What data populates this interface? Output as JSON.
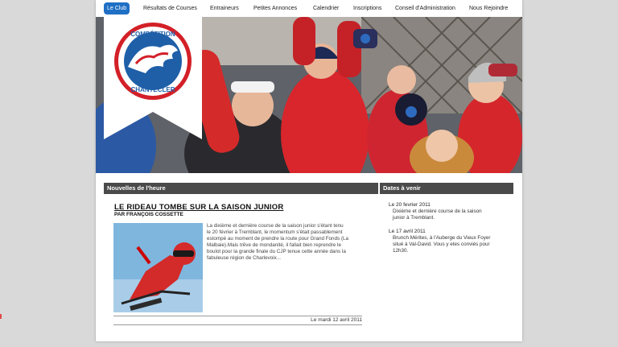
{
  "nav": {
    "items": [
      {
        "label": "Le Club",
        "active": true
      },
      {
        "label": "Résultats de Courses",
        "active": false
      },
      {
        "label": "Entraineurs",
        "active": false
      },
      {
        "label": "Petites Annonces",
        "active": false
      },
      {
        "label": "Calendrier",
        "active": false
      },
      {
        "label": "Inscriptions",
        "active": false
      },
      {
        "label": "Conseil d'Administration",
        "active": false
      },
      {
        "label": "Nous Rejoindre",
        "active": false
      }
    ]
  },
  "logo": {
    "text_top": "COMPÉTITION",
    "text_bottom": "CHANTECLER"
  },
  "news": {
    "section_title": "Nouvelles de l'heure",
    "article": {
      "title": "LE RIDEAU TOMBE SUR LA SAISON JUNIOR",
      "byline": "PAR FRANÇOIS COSSETTE",
      "body_lines": [
        "La dixième et dernière course de la saison junior s'étant tenu",
        "le 20 février à Tremblant, le momentum s'était passablement",
        "estompé au moment de prendre la route pour Grand Fonds (La",
        "Malbaie).Mais trêve de mondanité, il fallait bien reprendre le",
        "boulot pour la grande finale du CJP tenue cette année dans la",
        "fabuleuse région de Charlevoix..."
      ],
      "date": "Le mardi 12 avril 2011"
    }
  },
  "upcoming": {
    "section_title": "Dates à venir",
    "events": [
      {
        "date": "Le 20 fevrier 2011",
        "lines": [
          "Dixième et dernière course de la saison",
          "junior à Tremblant."
        ]
      },
      {
        "date": "Le 17 avril 2011",
        "lines": [
          "Brunch Mérites, à l'Auberge du Vieux Foyer",
          "situé à Val-David. Vous y etes conviés pour",
          "12h30."
        ]
      }
    ]
  },
  "colors": {
    "accent": "#1f6fc4",
    "section_bar": "#4a4a4a",
    "logo_red": "#d32028",
    "logo_blue": "#1f5fa8"
  }
}
